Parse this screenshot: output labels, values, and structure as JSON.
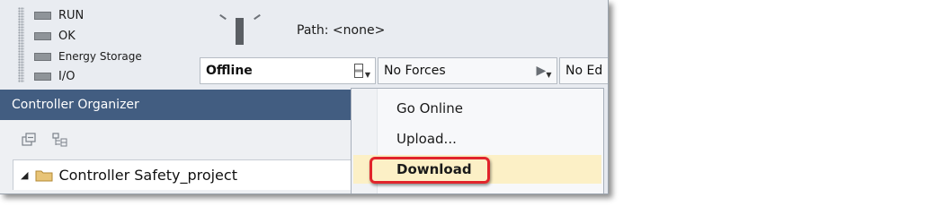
{
  "status": {
    "items": [
      {
        "label": "RUN"
      },
      {
        "label": "OK"
      },
      {
        "label": "Energy Storage"
      },
      {
        "label": "I/O"
      }
    ],
    "path_label": "Path: <none>"
  },
  "mode_bar": {
    "online_state": "Offline",
    "forces": "No Forces",
    "edits": "No Ed"
  },
  "organizer": {
    "title": "Controller Organizer",
    "tree_root": "Controller Safety_project"
  },
  "menu": {
    "items": [
      {
        "label": "Go Online"
      },
      {
        "label": "Upload..."
      },
      {
        "label": "Download"
      }
    ],
    "highlighted": "Download",
    "highlight_color": "#e1242b",
    "hover_bg": "#fcf0c6"
  },
  "colors": {
    "organizer_header": "#425d81"
  }
}
